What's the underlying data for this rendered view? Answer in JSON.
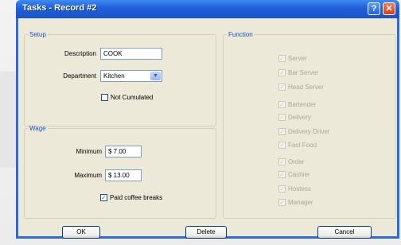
{
  "window": {
    "title": "Tasks - Record #2"
  },
  "setup": {
    "legend": "Setup",
    "description_label": "Description",
    "description_value": "COOK",
    "department_label": "Department",
    "department_value": "Kitchen",
    "not_cumulated_label": "Not Cumulated",
    "not_cumulated_checked": false
  },
  "wage": {
    "legend": "Wage",
    "minimum_label": "Minimum",
    "minimum_value": "$ 7.00",
    "maximum_label": "Maximum",
    "maximum_value": "$ 13.00",
    "paid_coffee_label": "Paid coffee breaks",
    "paid_coffee_checked": true
  },
  "function": {
    "legend": "Function",
    "items": [
      {
        "label": "Server",
        "checked": true
      },
      {
        "label": "Bar Server",
        "checked": true
      },
      {
        "label": "Head Server",
        "checked": true
      },
      {
        "label": "Bartender",
        "checked": true
      },
      {
        "label": "Delivery",
        "checked": true
      },
      {
        "label": "Delivery Driver",
        "checked": true
      },
      {
        "label": "Fast Food",
        "checked": true
      },
      {
        "label": "Order",
        "checked": true
      },
      {
        "label": "Cashier",
        "checked": true
      },
      {
        "label": "Hostess",
        "checked": true
      },
      {
        "label": "Manager",
        "checked": true
      }
    ]
  },
  "buttons": {
    "ok": "OK",
    "delete": "Delete",
    "cancel": "Cancel"
  },
  "icons": {
    "help": "help-icon",
    "close": "close-icon",
    "dropdown": "chevron-down-icon",
    "check": "checkmark-icon"
  }
}
